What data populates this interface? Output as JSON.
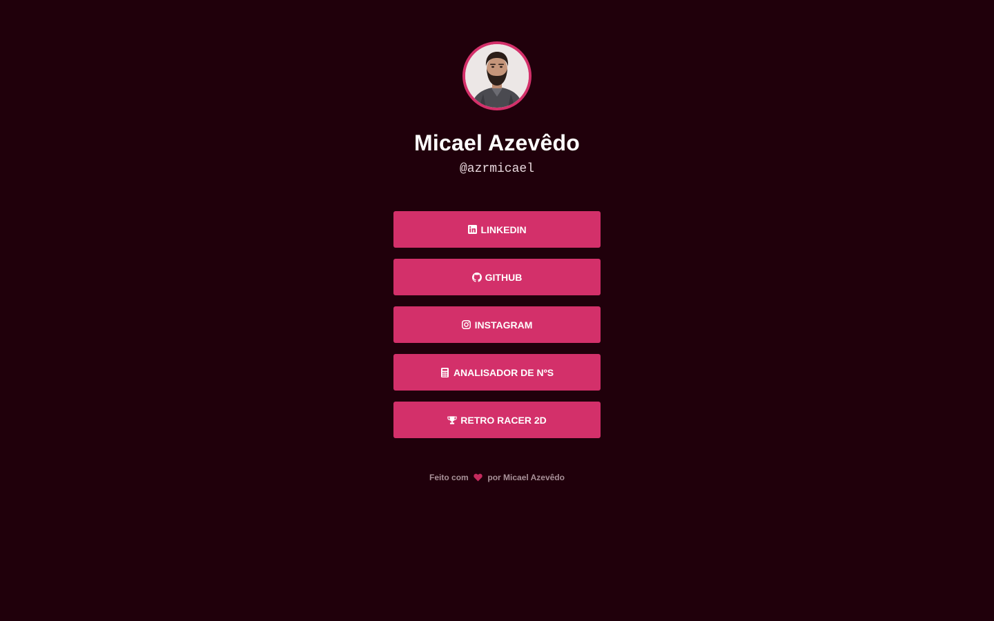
{
  "profile": {
    "name": "Micael Azevêdo",
    "handle": "@azrmicael",
    "avatar_icon": "profile-photo"
  },
  "links": [
    {
      "label": "LINKEDIN",
      "icon": "linkedin-icon"
    },
    {
      "label": "GITHUB",
      "icon": "github-icon"
    },
    {
      "label": "INSTAGRAM",
      "icon": "instagram-icon"
    },
    {
      "label": "ANALISADOR DE NºS",
      "icon": "calculator-icon"
    },
    {
      "label": "RETRO RACER 2D",
      "icon": "trophy-icon"
    }
  ],
  "footer": {
    "before": "Feito com",
    "after": "por Micael Azevêdo",
    "icon": "heart-icon"
  },
  "colors": {
    "background": "#20000b",
    "accent": "#d3306a",
    "footer_text": "#a89098",
    "heart": "#c42a5d"
  }
}
